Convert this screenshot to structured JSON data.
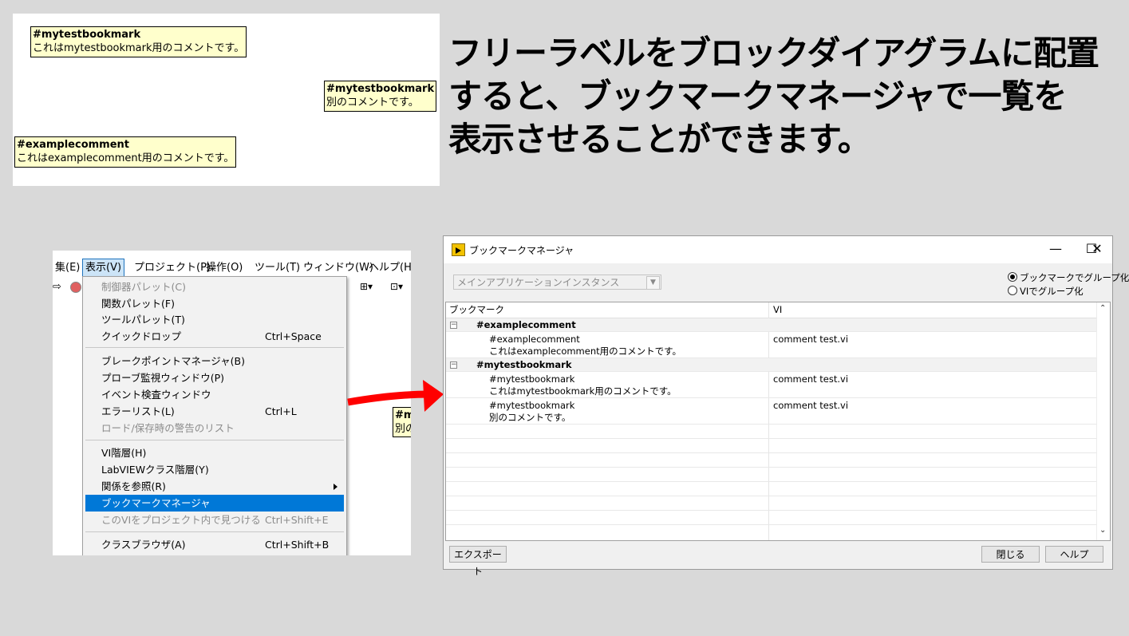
{
  "labels": {
    "label1": {
      "tag": "#mytestbookmark",
      "comment": "これはmytestbookmark用のコメントです。"
    },
    "label2": {
      "tag": "#mytestbookmark",
      "comment": "別のコメントです。"
    },
    "label3": {
      "tag": "#examplecomment",
      "comment": "これはexamplecomment用のコメントです。"
    }
  },
  "heading": {
    "line1": "フリーラベルをブロックダイアグラムに配置",
    "line2": "すると、ブックマークマネージャで一覧を",
    "line3": "表示させることができます。"
  },
  "menu": {
    "menubar": [
      {
        "label": "集(E)"
      },
      {
        "label": "表示(V)"
      },
      {
        "label": "プロジェクト(P)"
      },
      {
        "label": "操作(O)"
      },
      {
        "label": "ツール(T)"
      },
      {
        "label": "ウィンドウ(W)"
      },
      {
        "label": "ヘルプ(H)"
      }
    ],
    "items": [
      {
        "label": "制御器パレット(C)",
        "shortcut": ""
      },
      {
        "label": "関数パレット(F)",
        "shortcut": ""
      },
      {
        "label": "ツールパレット(T)",
        "shortcut": ""
      },
      {
        "label": "クイックドロップ",
        "shortcut": "Ctrl+Space"
      },
      {
        "label": "ブレークポイントマネージャ(B)",
        "shortcut": ""
      },
      {
        "label": "プローブ監視ウィンドウ(P)",
        "shortcut": ""
      },
      {
        "label": "イベント検査ウィンドウ",
        "shortcut": ""
      },
      {
        "label": "エラーリスト(L)",
        "shortcut": "Ctrl+L"
      },
      {
        "label": "ロード/保存時の警告のリスト",
        "shortcut": ""
      },
      {
        "label": "VI階層(H)",
        "shortcut": ""
      },
      {
        "label": "LabVIEWクラス階層(Y)",
        "shortcut": ""
      },
      {
        "label": "関係を参照(R)",
        "shortcut": ""
      },
      {
        "label": "ブックマークマネージャ",
        "shortcut": ""
      },
      {
        "label": "このVIをプロジェクト内で見つける",
        "shortcut": "Ctrl+Shift+E"
      },
      {
        "label": "クラスブラウザ(A)",
        "shortcut": "Ctrl+Shift+B"
      }
    ],
    "partial_label": {
      "line1": "#m",
      "line2": "別の"
    }
  },
  "bookmark_manager": {
    "title": "ブックマークマネージャ",
    "minimize": "—",
    "maximize": "☐",
    "close": "✕",
    "instance_combo": "メインアプリケーションインスタンス",
    "radio_group_by_bookmark": "ブックマークでグループ化",
    "radio_group_by_vi": "VIでグループ化",
    "col_bookmark": "ブックマーク",
    "col_vi": "VI",
    "groups": [
      {
        "name": "#examplecomment",
        "entries": [
          {
            "tag": "#examplecomment",
            "comment": "これはexamplecomment用のコメントです。",
            "vi": "comment test.vi"
          }
        ]
      },
      {
        "name": "#mytestbookmark",
        "entries": [
          {
            "tag": "#mytestbookmark",
            "comment": "これはmytestbookmark用のコメントです。",
            "vi": "comment test.vi"
          },
          {
            "tag": "#mytestbookmark",
            "comment": "別のコメントです。",
            "vi": "comment test.vi"
          }
        ]
      }
    ],
    "export_button": "エクスポート",
    "close_button": "閉じる",
    "help_button": "ヘルプ"
  },
  "colors": {
    "background": "#d9d9d9",
    "label_fill": "#ffffcc",
    "menu_highlight": "#0078d7",
    "arrow": "#ff0000"
  }
}
